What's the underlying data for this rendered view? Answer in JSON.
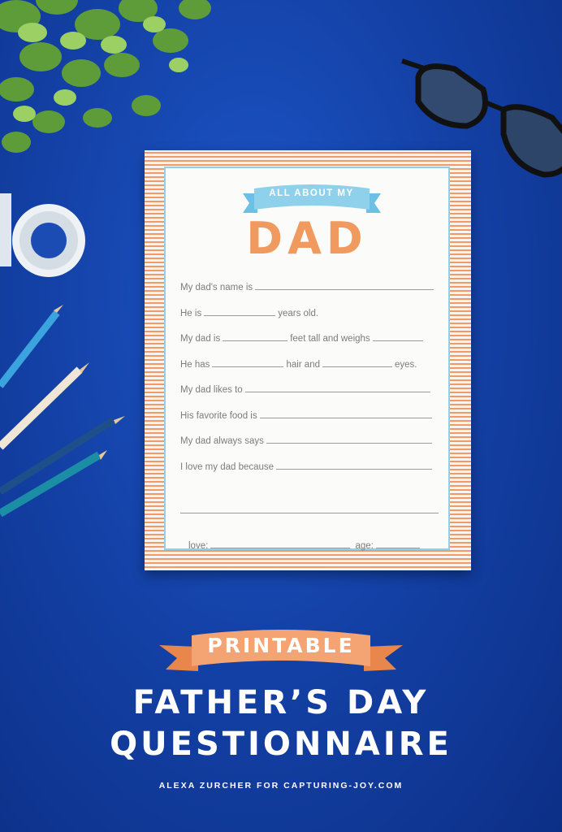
{
  "card": {
    "banner_text": "ALL ABOUT MY",
    "title": "DAD",
    "lines": [
      {
        "prefix": "My dad's name is",
        "middle": "",
        "suffix": ""
      },
      {
        "prefix": "He is",
        "middle": "years old.",
        "suffix": ""
      },
      {
        "prefix": "My dad is",
        "middle": "feet tall and weighs",
        "suffix": ""
      },
      {
        "prefix": "He has",
        "middle": "hair and",
        "suffix": "eyes."
      },
      {
        "prefix": "My dad likes to",
        "middle": "",
        "suffix": ""
      },
      {
        "prefix": "His favorite food is",
        "middle": "",
        "suffix": ""
      },
      {
        "prefix": "My dad always says",
        "middle": "",
        "suffix": ""
      },
      {
        "prefix": "I love my dad because",
        "middle": "",
        "suffix": ""
      }
    ],
    "love_label": "love:",
    "age_label": "age:"
  },
  "poster": {
    "ribbon_text": "PRINTABLE",
    "headline_line1": "FATHER’S DAY",
    "headline_line2": "QUESTIONNAIRE",
    "credit": "ALEXA ZURCHER FOR CAPTURING-JOY.COM"
  },
  "colors": {
    "background": "#1546ad",
    "accent_orange": "#f09a5f",
    "accent_blue": "#8fd0ea"
  }
}
